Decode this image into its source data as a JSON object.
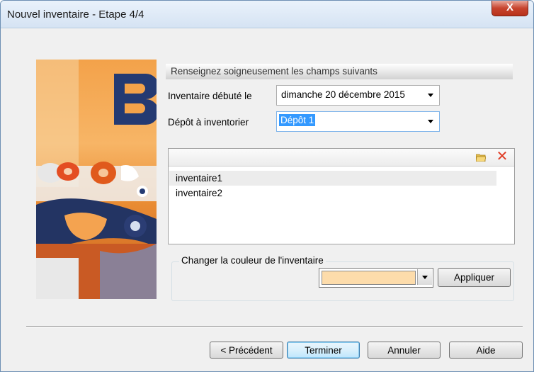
{
  "window": {
    "title": "Nouvel inventaire - Etape 4/4",
    "close_label": "X"
  },
  "form": {
    "header": "Renseignez soigneusement les champs suivants",
    "start_label": "Inventaire débuté le",
    "start_value": "dimanche 20 décembre 2015",
    "depot_label": "Dépôt à inventorier",
    "depot_value": "Dépôt 1"
  },
  "list": {
    "items": [
      "inventaire1",
      "inventaire2"
    ],
    "selected_index": 0
  },
  "color_group": {
    "legend": "Changer la couleur de l'inventaire",
    "current_color": "#fddcab",
    "apply_label": "Appliquer"
  },
  "buttons": {
    "previous": "< Précédent",
    "finish": "Terminer",
    "cancel": "Annuler",
    "help": "Aide"
  },
  "colors": {
    "delete_icon": "#e03b24",
    "selection": "#3399ff"
  }
}
